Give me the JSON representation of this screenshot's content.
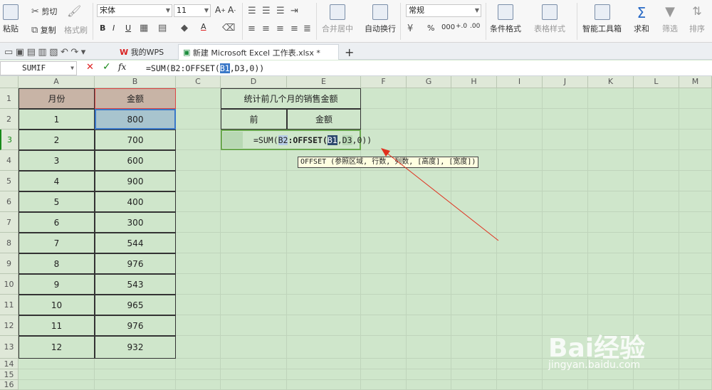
{
  "ribbon": {
    "paste": "粘贴",
    "cut": "剪切",
    "copy": "复制",
    "format_painter": "格式刷",
    "font_name": "宋体",
    "font_size": "11",
    "merge_center": "合并居中",
    "wrap_text": "自动换行",
    "number_format": "常规",
    "conditional_format": "条件格式",
    "table_style": "表格样式",
    "smart_toolbox": "智能工具箱",
    "sum": "求和",
    "filter": "筛选",
    "sort": "排序",
    "percent": "%",
    "thousands": "000"
  },
  "tabs": {
    "mywps": "我的WPS",
    "file": "新建 Microsoft Excel 工作表.xlsx *",
    "add": "+"
  },
  "formula_bar": {
    "name_box": "SUMIF",
    "cancel": "✕",
    "confirm": "✓",
    "fx": "fx",
    "formula_pre": "=SUM(B2:OFFSET(",
    "formula_hl": "B1",
    "formula_post": ",D3,0))"
  },
  "columns": [
    "A",
    "B",
    "C",
    "D",
    "E",
    "F",
    "G",
    "H",
    "I",
    "J",
    "K",
    "L",
    "M"
  ],
  "rows": [
    "1",
    "2",
    "3",
    "4",
    "5",
    "6",
    "7",
    "8",
    "9",
    "10",
    "11",
    "12",
    "13",
    "14",
    "15",
    "16"
  ],
  "table1": {
    "header_month": "月份",
    "header_amount": "金额",
    "data": [
      [
        "1",
        "800"
      ],
      [
        "2",
        "700"
      ],
      [
        "3",
        "600"
      ],
      [
        "4",
        "900"
      ],
      [
        "5",
        "400"
      ],
      [
        "6",
        "300"
      ],
      [
        "7",
        "544"
      ],
      [
        "8",
        "976"
      ],
      [
        "9",
        "543"
      ],
      [
        "10",
        "965"
      ],
      [
        "11",
        "976"
      ],
      [
        "12",
        "932"
      ]
    ]
  },
  "table2": {
    "title": "统计前几个月的销售金额",
    "col_prev": "前",
    "col_amount": "金额",
    "edit_pre": "=SUM(",
    "edit_b2": "B2",
    "edit_mid": ":OFFSET(",
    "edit_b1": "B1",
    "edit_comma": ",",
    "edit_d3": "D3",
    "edit_post": ",0))"
  },
  "tooltip": "OFFSET (参照区域, 行数, 列数, [高度], [宽度])",
  "watermark": {
    "brand": "Bai经验",
    "url": "jingyan.baidu.com"
  },
  "colors": {
    "header_fill": "#c8b4a6",
    "selected_fill": "#a8c4ce",
    "grid_bg": "#cfe6cb",
    "arrow": "#e0301e"
  }
}
